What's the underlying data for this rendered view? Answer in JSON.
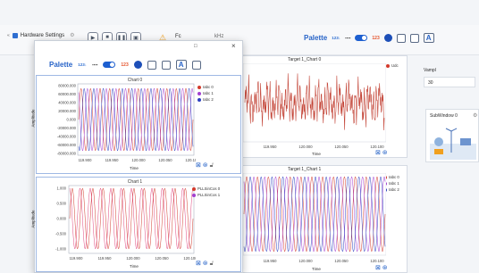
{
  "topbar": {
    "tab_label": "Hardware Settings",
    "fc_label": "Fc",
    "khz_label": "kHz",
    "palette_label": "Palette",
    "num_badge": "123↓",
    "dots_badge": "▪▪▪▪",
    "red_num": "123",
    "a_label": "A"
  },
  "float_window": {
    "restore_icon": "□",
    "close_icon": "×",
    "palette_label": "Palette",
    "num_badge": "123↓",
    "dots_badge": "▪▪▪▪",
    "red_num": "123",
    "a_label": "A",
    "chart0": {
      "title": "Chart 0",
      "ylabel": "Amplitude",
      "xlabel": "Time",
      "yticks": [
        "80000.000",
        "60000.000",
        "40000.000",
        "20000.000",
        "0.000",
        "-20000.000",
        "-40000.000",
        "-60000.000",
        "-80000.000"
      ],
      "xticks": [
        "119.900",
        "119.950",
        "120.000",
        "120.050",
        "120.100"
      ],
      "legend": [
        "Iabc 0",
        "Iabc 1",
        "Iabc 2"
      ]
    },
    "chart1": {
      "title": "Chart 1",
      "ylabel": "Amplitude",
      "xlabel": "Time",
      "yticks": [
        "1.000",
        "0.500",
        "0.000",
        "-0.500",
        "-1.000"
      ],
      "xticks": [
        "119.900",
        "119.950",
        "120.000",
        "120.050",
        "120.100"
      ],
      "legend": [
        "PLLSinCos 0",
        "PLLSinCos 1"
      ]
    }
  },
  "main": {
    "target_chart0": {
      "title": "Target 1_Chart 0",
      "xlabel": "Time",
      "xticks": [
        "119.950",
        "120.000",
        "120.050",
        "120.100"
      ],
      "legend": [
        "Udc"
      ]
    },
    "target_chart1": {
      "title": "Target 1_Chart 1",
      "xlabel": "Time",
      "xticks": [
        "119.950",
        "120.000",
        "120.050",
        "120.100"
      ],
      "legend": [
        "Iabc 0",
        "Iabc 1",
        "Iabc 2"
      ]
    }
  },
  "right": {
    "vampl_label": "Vampl",
    "vampl_value": "30",
    "subwindow_label": "SubWindow 0"
  },
  "colors": {
    "red": "#d33a2c",
    "purple": "#a23fd0",
    "blue": "#2a3fbf",
    "pink": "#e0447c",
    "accent": "#2864c8"
  }
}
